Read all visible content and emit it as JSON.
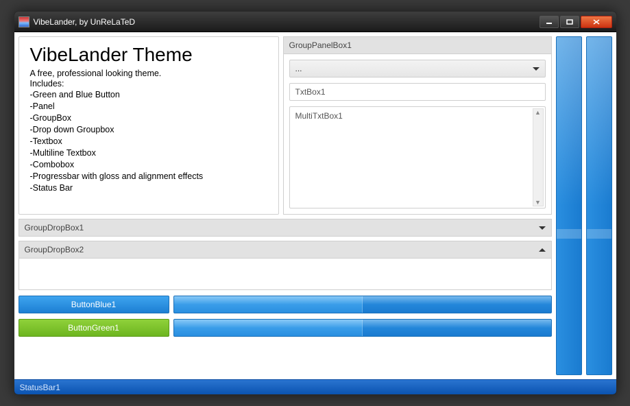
{
  "window": {
    "title": "VibeLander, by UnReLaTeD"
  },
  "theme": {
    "heading": "VibeLander Theme",
    "subtitle": "A free, professional looking theme.",
    "includes_label": "Includes:",
    "features": [
      "-Green and Blue Button",
      "-Panel",
      "-GroupBox",
      "-Drop down Groupbox",
      "-Textbox",
      "-Multiline Textbox",
      "-Combobox",
      "-Progressbar with gloss and alignment effects",
      "-Status Bar"
    ]
  },
  "grouppanel": {
    "title": "GroupPanelBox1",
    "combo_value": "...",
    "textbox_value": "TxtBox1",
    "multitext_value": "MultiTxtBox1"
  },
  "dropbox1": {
    "title": "GroupDropBox1",
    "expanded": false
  },
  "dropbox2": {
    "title": "GroupDropBox2",
    "expanded": true
  },
  "buttons": {
    "blue_label": "ButtonBlue1",
    "green_label": "ButtonGreen1"
  },
  "progress": {
    "p1_percent": 50,
    "p2_percent": 50
  },
  "vertbars": {
    "bar1_marker_top_percent": 88,
    "bar2_marker_top_percent": 88
  },
  "statusbar": {
    "text": "StatusBar1"
  },
  "colors": {
    "blue": "#1c7fd3",
    "green": "#6db51f",
    "panel_border": "#cfcfcf"
  }
}
